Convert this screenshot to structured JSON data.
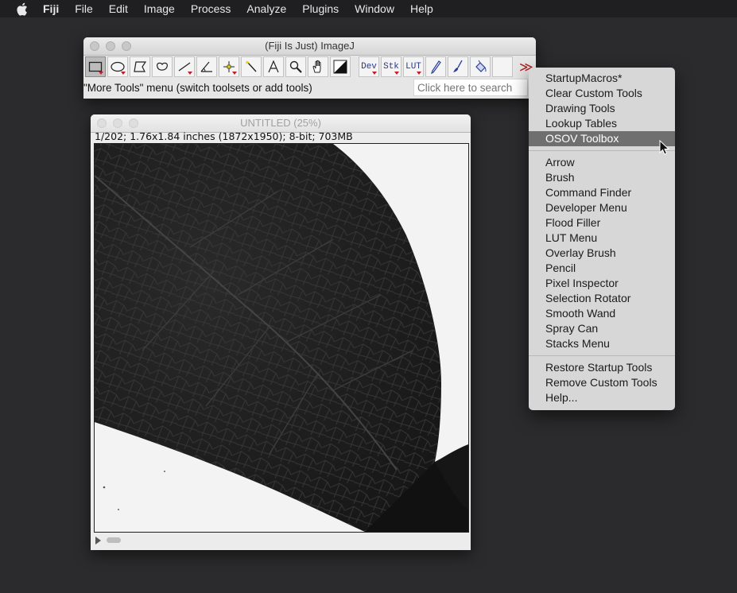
{
  "menubar": {
    "app": "Fiji",
    "items": [
      "File",
      "Edit",
      "Image",
      "Process",
      "Analyze",
      "Plugins",
      "Window",
      "Help"
    ]
  },
  "imagej_window": {
    "title": "(Fiji Is Just) ImageJ",
    "tools": [
      {
        "name": "rectangle-tool",
        "icon": "rectangle-icon",
        "selected": true
      },
      {
        "name": "oval-tool",
        "icon": "oval-icon"
      },
      {
        "name": "polygon-tool",
        "icon": "polygon-icon"
      },
      {
        "name": "freehand-tool",
        "icon": "freehand-icon"
      },
      {
        "name": "line-tool",
        "icon": "line-icon"
      },
      {
        "name": "angle-tool",
        "icon": "angle-icon"
      },
      {
        "name": "point-tool",
        "icon": "point-icon"
      },
      {
        "name": "wand-tool",
        "icon": "wand-icon"
      },
      {
        "name": "text-tool",
        "icon": "text-icon"
      },
      {
        "name": "magnifier-tool",
        "icon": "magnifier-icon"
      },
      {
        "name": "hand-tool",
        "icon": "hand-icon"
      },
      {
        "name": "color-picker-tool",
        "icon": "color-picker-icon"
      }
    ],
    "menu_tools": [
      "Dev",
      "Stk",
      "LUT"
    ],
    "extra_tools": [
      "pencil-icon",
      "brush-icon",
      "flood-filler-icon"
    ],
    "more_tools_glyph": "≫",
    "status": "\"More Tools\" menu (switch toolsets or add tools)",
    "search_placeholder": "Click here to search",
    "accent": "#c0202a"
  },
  "image_window": {
    "title": "UNTITLED (25%)",
    "info": "1/202; 1.76x1.84 inches (1872x1950); 8-bit; 703MB"
  },
  "dropdown": {
    "group1": [
      "StartupMacros*",
      "Clear Custom Tools",
      "Drawing Tools",
      "Lookup Tables",
      "OSOV Toolbox"
    ],
    "highlighted": "OSOV Toolbox",
    "group2": [
      "Arrow",
      "Brush",
      "Command Finder",
      "Developer Menu",
      "Flood Filler",
      "LUT Menu",
      "Overlay Brush",
      "Pencil",
      "Pixel Inspector",
      "Selection Rotator",
      "Smooth Wand",
      "Spray Can",
      "Stacks Menu"
    ],
    "group3": [
      "Restore Startup Tools",
      "Remove Custom Tools",
      "Help..."
    ]
  }
}
